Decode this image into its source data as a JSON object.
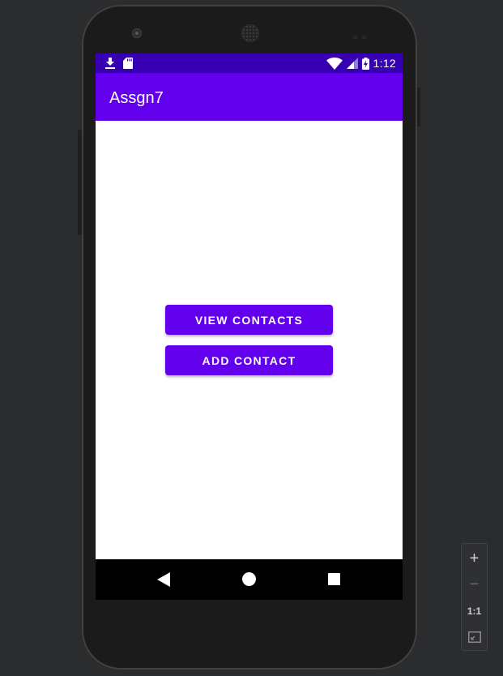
{
  "statusbar": {
    "time": "1:12",
    "left_icons": [
      "download-icon",
      "sd-card-icon"
    ],
    "right_icons": [
      "wifi-icon",
      "signal-icon",
      "battery-charging-icon"
    ]
  },
  "app": {
    "title": "Assgn7"
  },
  "buttons": {
    "view_contacts": "VIEW CONTACTS",
    "add_contact": "ADD CONTACT"
  },
  "navbar": {
    "icons": [
      "back-icon",
      "home-icon",
      "recents-icon"
    ]
  },
  "zoom_controls": {
    "zoom_in": "+",
    "zoom_out": "−",
    "actual_size": "1:1",
    "fit_icon": "fit-screen-icon"
  },
  "colors": {
    "status_bar": "#3700b3",
    "app_bar": "#6200ee",
    "button": "#6200ee",
    "background": "#ffffff"
  }
}
